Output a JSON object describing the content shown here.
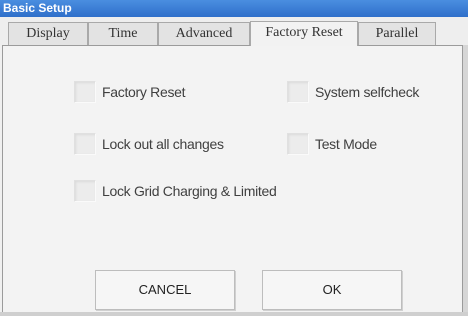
{
  "window": {
    "title": "Basic Setup"
  },
  "tabs": [
    {
      "label": "Display"
    },
    {
      "label": "Time"
    },
    {
      "label": "Advanced"
    },
    {
      "label": "Factory Reset"
    },
    {
      "label": "Parallel"
    }
  ],
  "active_tab": "Factory Reset",
  "options": {
    "factory_reset": {
      "label": "Factory Reset",
      "checked": false
    },
    "system_selfcheck": {
      "label": "System selfcheck",
      "checked": false
    },
    "lock_out_all_changes": {
      "label": "Lock out all changes",
      "checked": false
    },
    "test_mode": {
      "label": "Test Mode",
      "checked": false
    },
    "lock_grid_charging": {
      "label": "Lock Grid Charging & Limited",
      "checked": false
    }
  },
  "buttons": {
    "cancel": "CANCEL",
    "ok": "OK"
  }
}
